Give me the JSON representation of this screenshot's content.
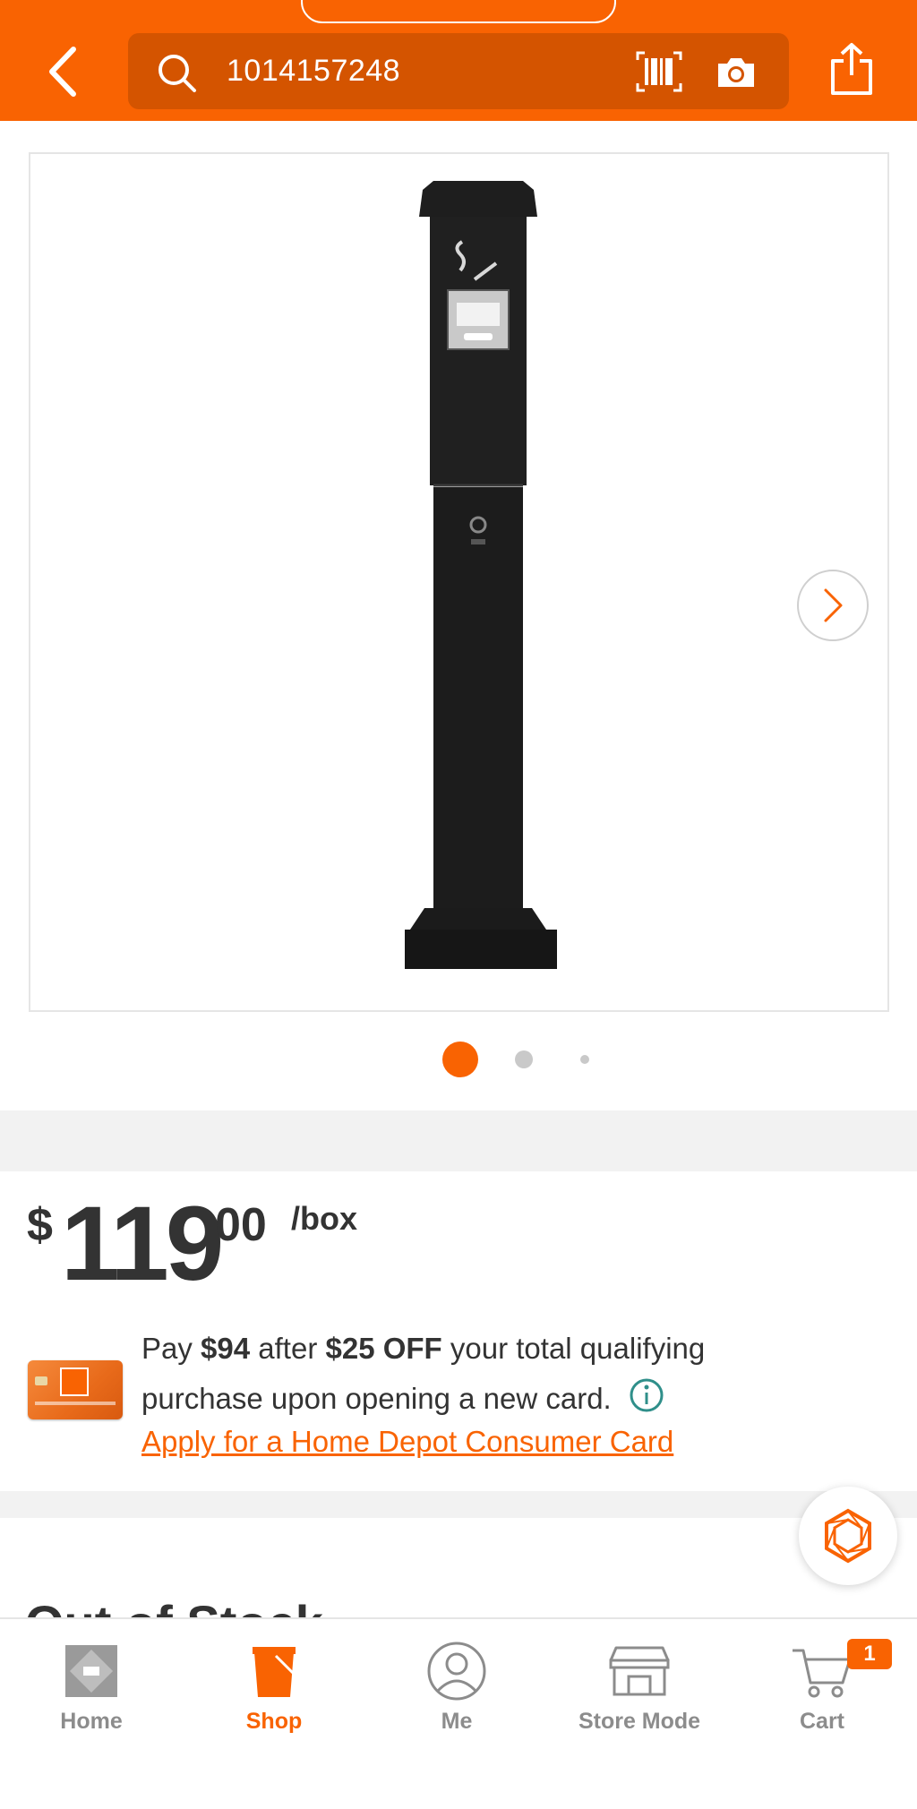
{
  "header": {
    "search_value": "1014157248",
    "icons": {
      "back": "back-arrow-icon",
      "search": "search-icon",
      "barcode": "barcode-scan-icon",
      "camera": "camera-icon",
      "share": "share-icon"
    }
  },
  "gallery": {
    "image_alt": "black pedestal cigarette receptacle post",
    "page_dots": 3,
    "active_dot": 1
  },
  "price": {
    "currency": "$",
    "dollars": "119",
    "cents": "00",
    "unit": "/box"
  },
  "promo": {
    "pay_label": "Pay",
    "pay_amount": "$94",
    "after_label": "after",
    "discount": "$25 OFF",
    "rest_line1": "your total qualifying",
    "rest_line2": "purchase upon opening a new card.",
    "apply_link": "Apply for a Home Depot Consumer Card"
  },
  "availability": {
    "heading": "Out of Stock"
  },
  "tabbar": {
    "tabs": [
      {
        "label": "Home",
        "icon": "home-depot-logo-icon",
        "active": false
      },
      {
        "label": "Shop",
        "icon": "shop-bucket-icon",
        "active": true
      },
      {
        "label": "Me",
        "icon": "person-icon",
        "active": false
      },
      {
        "label": "Store Mode",
        "icon": "store-icon",
        "active": false
      },
      {
        "label": "Cart",
        "icon": "cart-icon",
        "active": false,
        "badge": "1"
      }
    ]
  },
  "colors": {
    "brand_orange": "#f96302",
    "search_bg": "#d45400",
    "inactive_tab": "#8c8c8c"
  }
}
